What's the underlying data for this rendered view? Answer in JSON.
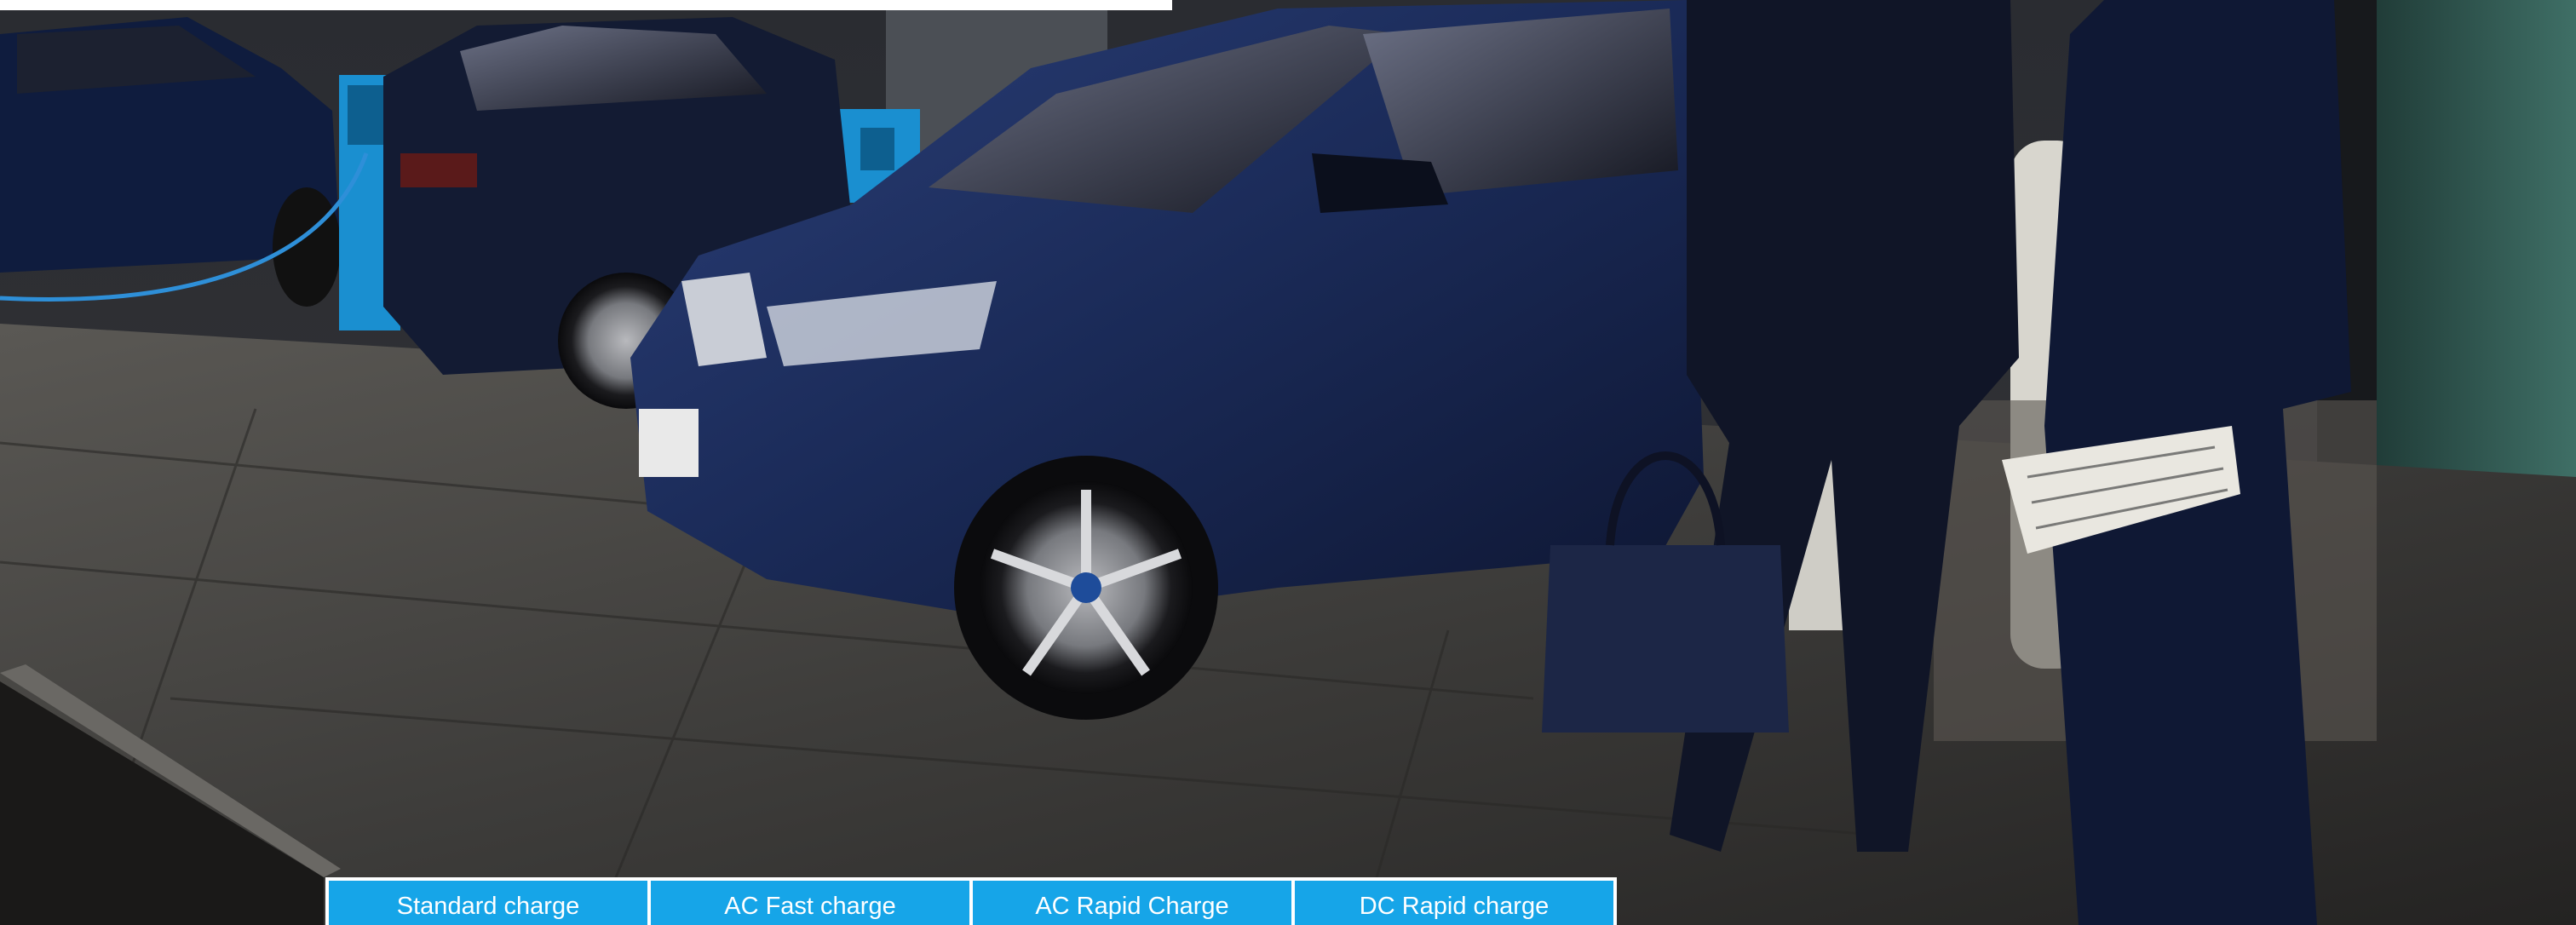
{
  "hero": {
    "image_alt": "",
    "icons": [
      "hero-photo"
    ]
  },
  "charging_tabs": [
    {
      "label": "Standard charge"
    },
    {
      "label": "AC Fast charge"
    },
    {
      "label": "AC Rapid Charge"
    },
    {
      "label": "DC Rapid charge"
    }
  ],
  "colors": {
    "tab_background": "#16a5e8",
    "tab_text": "#ffffff",
    "tab_border": "#ffffff",
    "top_strip": "#ffffff"
  }
}
